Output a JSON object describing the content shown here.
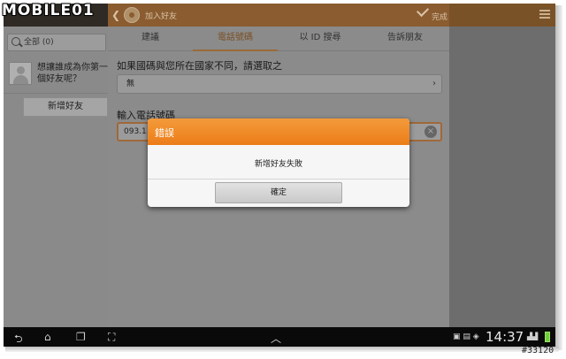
{
  "watermark": {
    "logo_text": "MOBILE01",
    "stamp": "#33120"
  },
  "left_panel": {
    "search_placeholder": "全部 (0)",
    "item_text": "想讓誰成為你第一個好友呢？",
    "add_button": "新增好友"
  },
  "header": {
    "title": "加入好友",
    "done_label": "完成"
  },
  "tabs": [
    {
      "label": "建議"
    },
    {
      "label": "電話號碼",
      "active": true
    },
    {
      "label": "以 ID 搜尋"
    },
    {
      "label": "告訴朋友"
    }
  ],
  "form": {
    "country_label": "如果國碼與您所在國家不同，請選取之",
    "country_value": "無",
    "phone_label": "輸入電話號碼",
    "phone_value": "093.1"
  },
  "dialog": {
    "title": "錯誤",
    "message": "新增好友失敗",
    "ok_button": "確定"
  },
  "status_bar": {
    "time": "14:37"
  },
  "colors": {
    "dialog_header": "#ec7d18",
    "accent": "#9a6a38"
  }
}
